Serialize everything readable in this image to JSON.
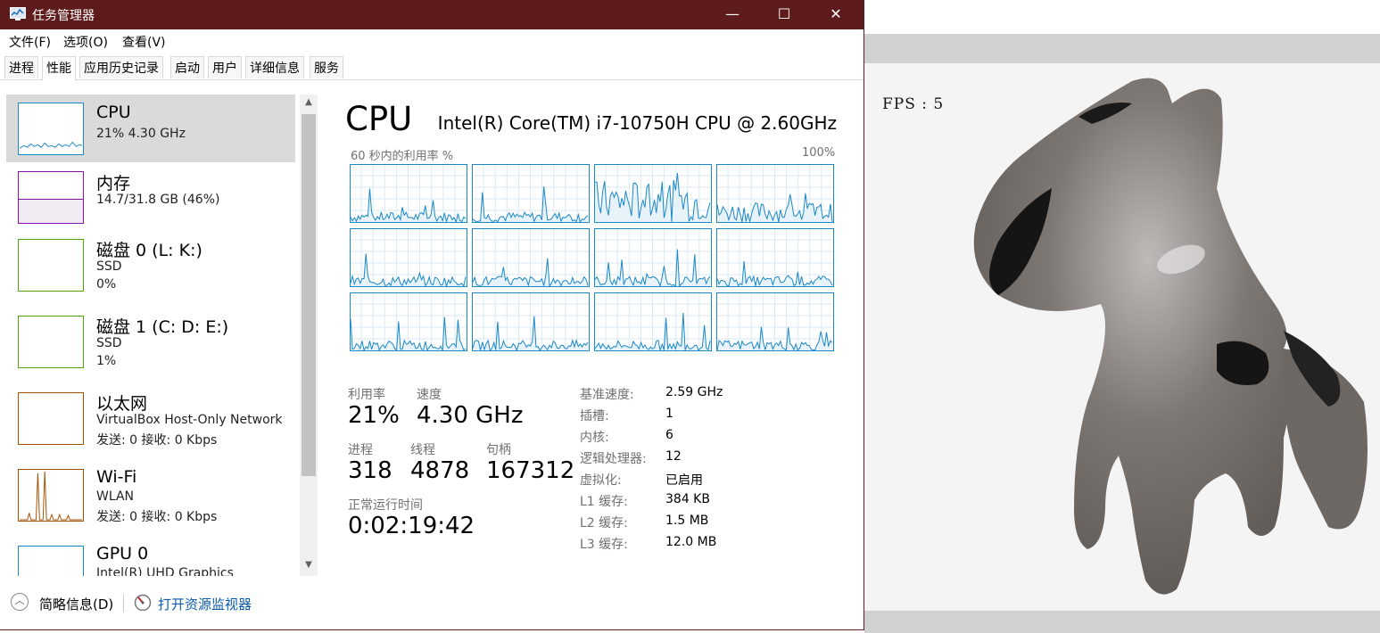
{
  "window": {
    "title": "任务管理器",
    "minimize": "—",
    "maximize": "☐",
    "close": "✕"
  },
  "menu": [
    "文件(F)",
    "选项(O)",
    "查看(V)"
  ],
  "tabs": [
    "进程",
    "性能",
    "应用历史记录",
    "启动",
    "用户",
    "详细信息",
    "服务"
  ],
  "active_tab": 1,
  "sidebar": [
    {
      "name": "CPU",
      "line2": "21%  4.30 GHz",
      "line3": "",
      "color": "#1a88c9"
    },
    {
      "name": "内存",
      "line2": "14.7/31.8 GB (46%)",
      "line3": "",
      "color": "#8b12ae"
    },
    {
      "name": "磁盘 0 (L: K:)",
      "line2": "SSD",
      "line3": "0%",
      "color": "#4da60c"
    },
    {
      "name": "磁盘 1 (C: D: E:)",
      "line2": "SSD",
      "line3": "1%",
      "color": "#4da60c"
    },
    {
      "name": "以太网",
      "line2": "VirtualBox Host-Only Network",
      "line3": "发送: 0 接收: 0 Kbps",
      "color": "#a74f01"
    },
    {
      "name": "Wi-Fi",
      "line2": "WLAN",
      "line3": "发送: 0 接收: 0 Kbps",
      "color": "#a74f01"
    },
    {
      "name": "GPU 0",
      "line2": "Intel(R) UHD Graphics",
      "line3": "",
      "color": "#1a88c9"
    }
  ],
  "cpu": {
    "title": "CPU",
    "model": "Intel(R) Core(TM) i7-10750H CPU @ 2.60GHz",
    "graph_label": "60 秒内的利用率 %",
    "graph_max": "100%",
    "stats": {
      "util_label": "利用率",
      "util_value": "21%",
      "speed_label": "速度",
      "speed_value": "4.30 GHz",
      "proc_label": "进程",
      "proc_value": "318",
      "thread_label": "线程",
      "thread_value": "4878",
      "handle_label": "句柄",
      "handle_value": "167312",
      "uptime_label": "正常运行时间",
      "uptime_value": "0:02:19:42"
    },
    "details": [
      {
        "k": "基准速度:",
        "v": "2.59 GHz"
      },
      {
        "k": "插槽:",
        "v": "1"
      },
      {
        "k": "内核:",
        "v": "6"
      },
      {
        "k": "逻辑处理器:",
        "v": "12"
      },
      {
        "k": "虚拟化:",
        "v": "已启用"
      },
      {
        "k": "L1 缓存:",
        "v": "384 KB"
      },
      {
        "k": "L2 缓存:",
        "v": "1.5 MB"
      },
      {
        "k": "L3 缓存:",
        "v": "12.0 MB"
      }
    ]
  },
  "memory_usage_fraction": 0.46,
  "footer": {
    "brief": "简略信息(D)",
    "monitor": "打开资源监视器"
  },
  "viewer": {
    "fps": "FPS : 5"
  }
}
